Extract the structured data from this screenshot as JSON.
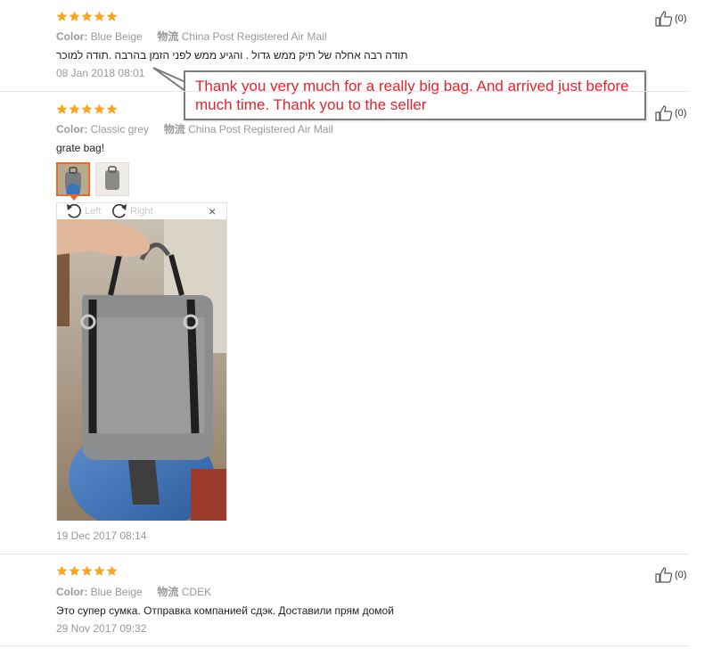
{
  "reviews": [
    {
      "rating": 5,
      "color_label": "Color:",
      "color_value": "Blue Beige",
      "shipping_label": "物流",
      "shipping_value": "China Post Registered Air Mail",
      "text": "תודה רבה אחלה של תיק ממש גדול . והגיע ממש לפני הזמן בהרבה .תודה למוכר",
      "date": "08 Jan 2018 08:01",
      "likes": "(0)"
    },
    {
      "rating": 5,
      "color_label": "Color:",
      "color_value": "Classic grey",
      "shipping_label": "物流",
      "shipping_value": "China Post Registered Air Mail",
      "text": "grate bag!",
      "date": "19 Dec 2017 08:14",
      "likes": "(0)"
    },
    {
      "rating": 5,
      "color_label": "Color:",
      "color_value": "Blue Beige",
      "shipping_label": "物流",
      "shipping_value": "CDEK",
      "text": "Это супер сумка. Отправка компанией сдэк. Доставили прям домой",
      "date": "29 Nov 2017 09:32",
      "likes": "(0)"
    }
  ],
  "translation_callout": "Thank you very much for a really big bag. And arrived just before much time. Thank you to the seller",
  "viewer": {
    "rotate_left": "Left",
    "rotate_right": "Right",
    "close": "×"
  },
  "colors": {
    "star": "#f5a623",
    "accent": "#f06a25",
    "callout_text": "#e8222c"
  }
}
